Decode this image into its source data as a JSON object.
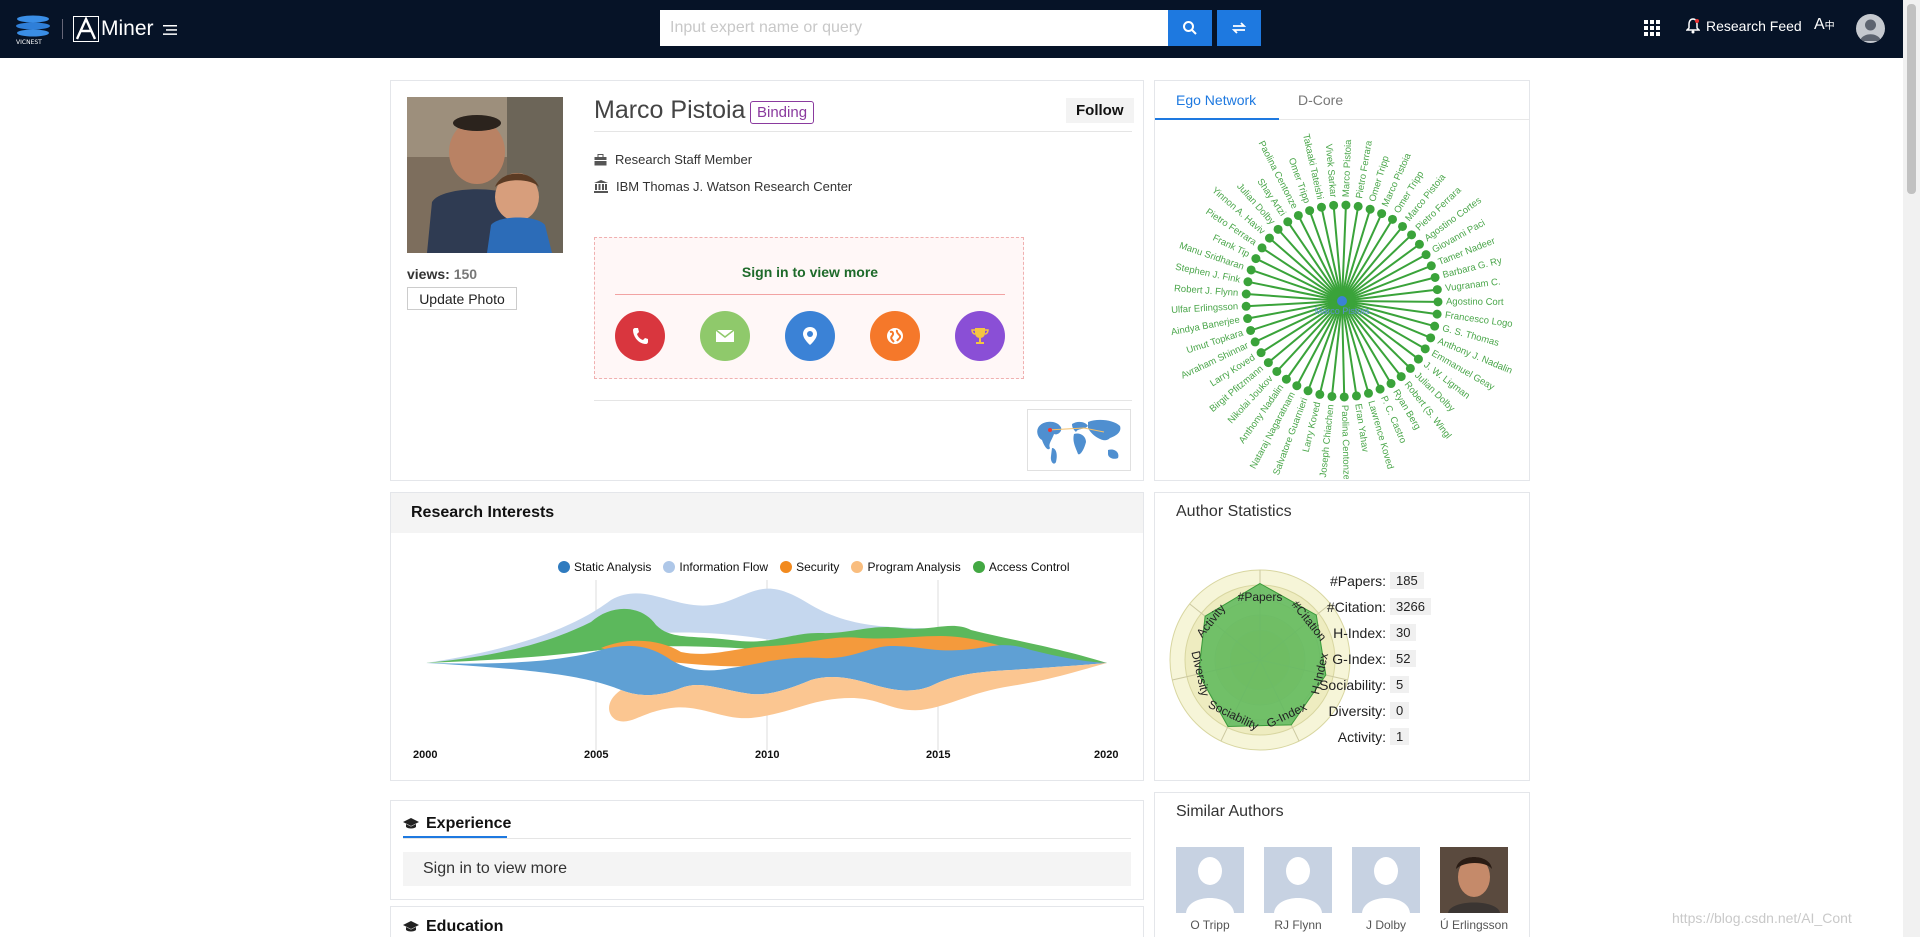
{
  "topbar": {
    "brand_left": "VICNEST",
    "brand_name": "Miner",
    "search_placeholder": "Input expert name or query",
    "research_feed": "Research Feed"
  },
  "profile": {
    "name": "Marco Pistoia",
    "binding": "Binding",
    "follow": "Follow",
    "views_label": "views:",
    "views_value": "150",
    "update_photo": "Update Photo",
    "position": "Research Staff Member",
    "affiliation": "IBM Thomas J. Watson Research Center",
    "sign_in_more": "Sign in to view more",
    "contact_icons": [
      {
        "name": "phone-icon",
        "color": "#d9363e"
      },
      {
        "name": "email-icon",
        "color": "#8fc96b"
      },
      {
        "name": "location-icon",
        "color": "#3b82d6"
      },
      {
        "name": "globe-icon",
        "color": "#f5782a"
      },
      {
        "name": "trophy-icon",
        "color": "#8a4fd6"
      }
    ]
  },
  "ego": {
    "tabs": [
      "Ego Network",
      "D-Core"
    ],
    "center": "Marco Pistoia",
    "nodes": [
      "Vivek Sarkar",
      "Marco Pistoia",
      "Pietro Ferrara",
      "Omer Tripp",
      "Marco Pistoia",
      "Omer Tripp",
      "Marco Pistoia",
      "Pietro Ferrara",
      "Agostino Cortes",
      "Giovanni Paci",
      "Tamer Nadeer",
      "Barbara G. Ry",
      "Vugranam C.",
      "Agostino Cort",
      "Francesco Logo",
      "G. S. Thomas",
      "Anthony J. Nadalin",
      "Emmanuel Geay",
      "J. W. Ligman",
      "Julian Dolby",
      "Robert (S. Wingl",
      "Ryan Berg",
      "P. C. Castro",
      "Lawrence Koved",
      "Eran Yahav",
      "Paolina Centonze",
      "Joseph Chiachen",
      "Larry Koved",
      "Salvatore Guarnieri",
      "Nataraj Nagaratnam",
      "Anthony Nadalin",
      "Nikolai Joukov",
      "Birgit Pfitzmann",
      "Larry Koved",
      "Avraham Shinnar",
      "Umut Topkara",
      "Aindya Banerjee",
      "Ulfar Erlingsson",
      "Robert J. Flynn",
      "Stephen J. Fink",
      "Manu Sridharan",
      "Frank Tip",
      "Pietro Ferrara",
      "Yinnon A. Haviv",
      "Julian Dolby",
      "Shay Artzi",
      "Paolina Centonze",
      "Omer Tripp",
      "Takaaki Tateishi"
    ]
  },
  "research": {
    "title": "Research Interests",
    "legend": [
      {
        "name": "Static Analysis",
        "color": "#2f7bbf"
      },
      {
        "name": "Information Flow",
        "color": "#aec7e8"
      },
      {
        "name": "Security",
        "color": "#f28a1e"
      },
      {
        "name": "Program Analysis",
        "color": "#f9bd7e"
      },
      {
        "name": "Access Control",
        "color": "#43a843"
      }
    ],
    "years": [
      "2000",
      "2005",
      "2010",
      "2015",
      "2020"
    ]
  },
  "stats": {
    "title": "Author Statistics",
    "radar_axes": [
      "#Papers",
      "#Citation",
      "H-Index",
      "G-Index",
      "Sociability",
      "Diversity",
      "Activity"
    ],
    "items": [
      {
        "label": "#Papers:",
        "value": "185"
      },
      {
        "label": "#Citation:",
        "value": "3266"
      },
      {
        "label": "H-Index:",
        "value": "30"
      },
      {
        "label": "G-Index:",
        "value": "52"
      },
      {
        "label": "Sociability:",
        "value": "5"
      },
      {
        "label": "Diversity:",
        "value": "0"
      },
      {
        "label": "Activity:",
        "value": "1"
      }
    ]
  },
  "similar": {
    "title": "Similar Authors",
    "authors": [
      "O Tripp",
      "RJ Flynn",
      "J Dolby",
      "Ú Erlingsson"
    ]
  },
  "experience": {
    "title": "Experience",
    "sign_in": "Sign in to view more"
  },
  "education": {
    "title": "Education"
  },
  "watermark": "https://blog.csdn.net/AI_Cont"
}
